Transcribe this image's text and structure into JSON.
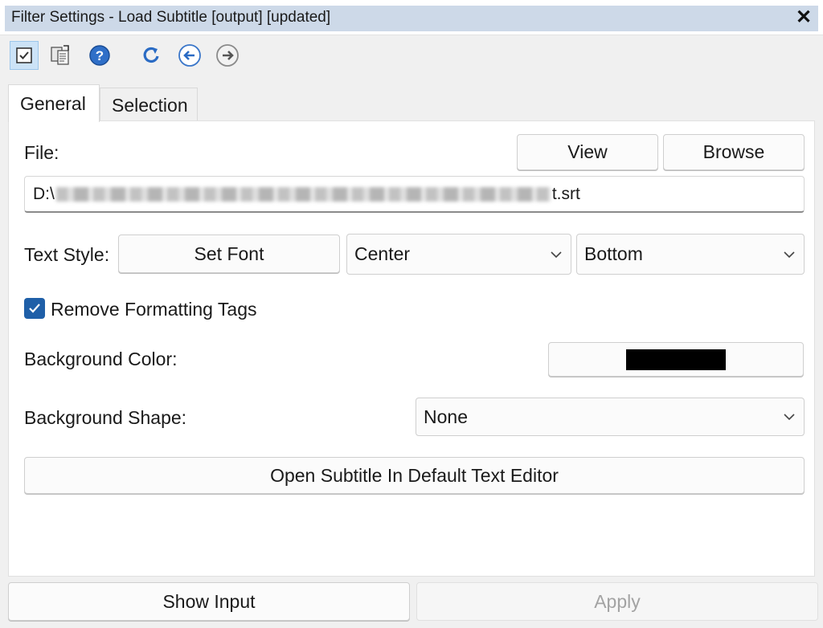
{
  "window": {
    "title": "Filter Settings - Load Subtitle [output] [updated]",
    "close_glyph": "✕"
  },
  "toolbar": {
    "buttons": [
      {
        "name": "preview-toggle-icon",
        "active": true
      },
      {
        "name": "copy-settings-icon",
        "active": false
      },
      {
        "name": "help-icon",
        "active": false
      },
      {
        "name": "reset-icon",
        "active": false
      },
      {
        "name": "back-arrow-icon",
        "active": false
      },
      {
        "name": "forward-arrow-icon",
        "active": false
      }
    ]
  },
  "tabs": [
    {
      "label": "General",
      "active": true
    },
    {
      "label": "Selection",
      "active": false
    }
  ],
  "general": {
    "file_label": "File:",
    "view_label": "View",
    "browse_label": "Browse",
    "file_path_prefix": "D:\\",
    "file_path_suffix": "t.srt",
    "text_style_label": "Text Style:",
    "set_font_label": "Set Font",
    "horizontal_align": "Center",
    "vertical_align": "Bottom",
    "remove_tags_label": "Remove Formatting Tags",
    "remove_tags_checked": true,
    "background_color_label": "Background Color:",
    "background_color": "#000000",
    "background_shape_label": "Background Shape:",
    "background_shape": "None",
    "open_editor_label": "Open Subtitle In Default Text Editor"
  },
  "footer": {
    "show_input_label": "Show Input",
    "apply_label": "Apply",
    "apply_enabled": false
  },
  "colors": {
    "accent": "#1f5fa8",
    "title_strip": "#cdd9e8"
  }
}
